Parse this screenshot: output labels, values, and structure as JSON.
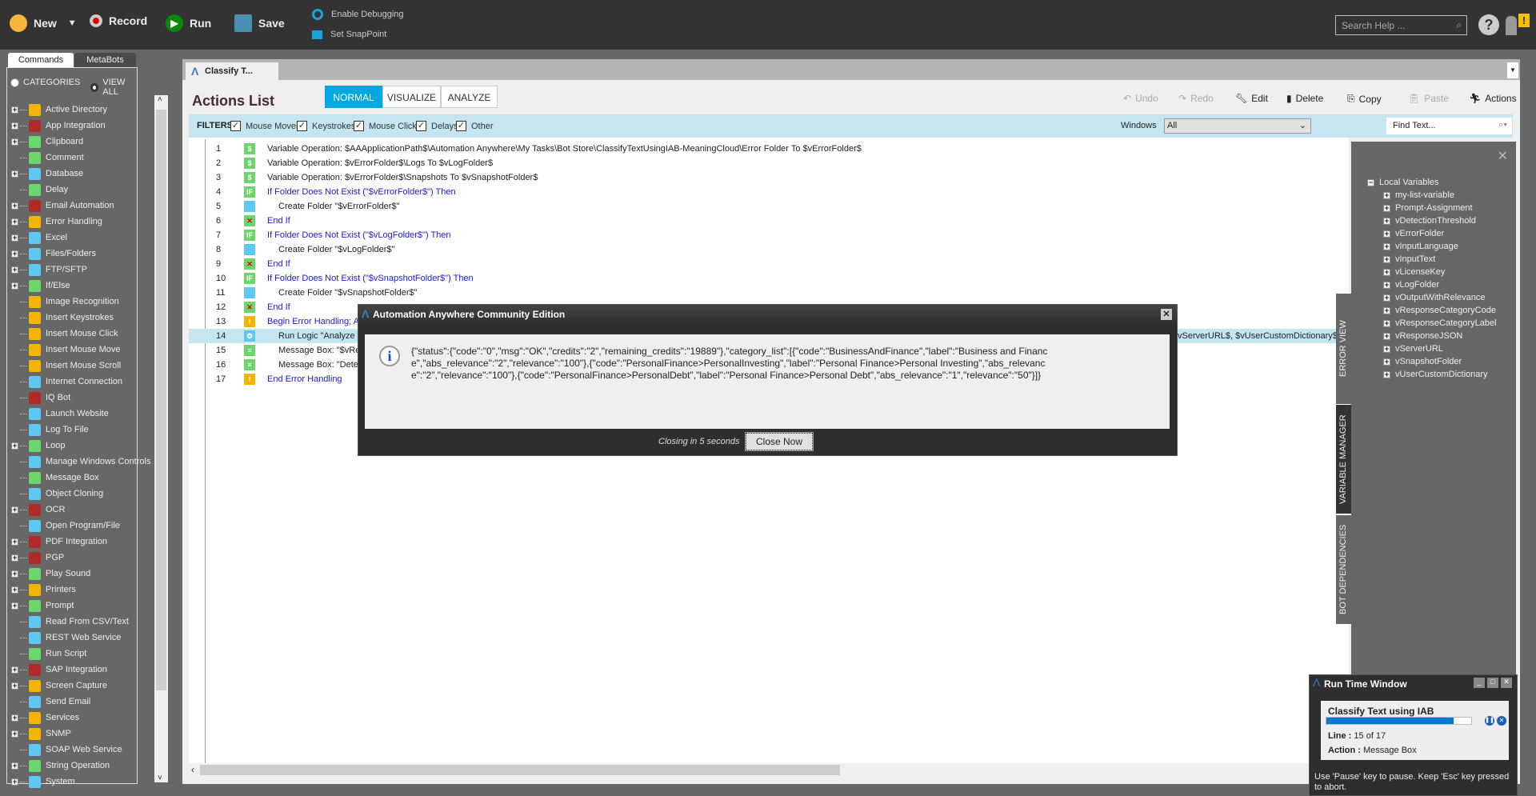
{
  "toolbar": {
    "new": "New",
    "record": "Record",
    "run": "Run",
    "save": "Save",
    "debug": "Enable Debugging",
    "snap": "Set SnapPoint",
    "search_placeholder": "Search Help ..."
  },
  "sidebar": {
    "tabs": [
      "Commands",
      "MetaBots"
    ],
    "radio_categories": "CATEGORIES",
    "radio_viewall": "VIEW ALL",
    "items": [
      {
        "label": "Active Directory",
        "exp": true,
        "color": "#f5b400"
      },
      {
        "label": "App Integration",
        "exp": true,
        "color": "#b02a2a"
      },
      {
        "label": "Clipboard",
        "exp": true,
        "color": "#6cd66c"
      },
      {
        "label": "Comment",
        "exp": false,
        "color": "#6cd66c"
      },
      {
        "label": "Database",
        "exp": true,
        "color": "#5ec8f0"
      },
      {
        "label": "Delay",
        "exp": false,
        "color": "#6cd66c"
      },
      {
        "label": "Email Automation",
        "exp": true,
        "color": "#b02a2a"
      },
      {
        "label": "Error Handling",
        "exp": true,
        "color": "#f5b400"
      },
      {
        "label": "Excel",
        "exp": true,
        "color": "#5ec8f0"
      },
      {
        "label": "Files/Folders",
        "exp": true,
        "color": "#5ec8f0"
      },
      {
        "label": "FTP/SFTP",
        "exp": true,
        "color": "#5ec8f0"
      },
      {
        "label": "If/Else",
        "exp": true,
        "color": "#6cd66c"
      },
      {
        "label": "Image Recognition",
        "exp": false,
        "color": "#f5b400"
      },
      {
        "label": "Insert Keystrokes",
        "exp": false,
        "color": "#f5b400"
      },
      {
        "label": "Insert Mouse Click",
        "exp": false,
        "color": "#f5b400"
      },
      {
        "label": "Insert Mouse Move",
        "exp": false,
        "color": "#f5b400"
      },
      {
        "label": "Insert Mouse Scroll",
        "exp": false,
        "color": "#f5b400"
      },
      {
        "label": "Internet Connection",
        "exp": false,
        "color": "#5ec8f0"
      },
      {
        "label": "IQ Bot",
        "exp": false,
        "color": "#b02a2a"
      },
      {
        "label": "Launch Website",
        "exp": false,
        "color": "#5ec8f0"
      },
      {
        "label": "Log To File",
        "exp": false,
        "color": "#5ec8f0"
      },
      {
        "label": "Loop",
        "exp": true,
        "color": "#6cd66c"
      },
      {
        "label": "Manage Windows Controls",
        "exp": false,
        "color": "#5ec8f0"
      },
      {
        "label": "Message Box",
        "exp": false,
        "color": "#6cd66c"
      },
      {
        "label": "Object Cloning",
        "exp": false,
        "color": "#5ec8f0"
      },
      {
        "label": "OCR",
        "exp": true,
        "color": "#b02a2a"
      },
      {
        "label": "Open Program/File",
        "exp": false,
        "color": "#5ec8f0"
      },
      {
        "label": "PDF Integration",
        "exp": true,
        "color": "#b02a2a"
      },
      {
        "label": "PGP",
        "exp": true,
        "color": "#b02a2a"
      },
      {
        "label": "Play Sound",
        "exp": true,
        "color": "#6cd66c"
      },
      {
        "label": "Printers",
        "exp": true,
        "color": "#f5b400"
      },
      {
        "label": "Prompt",
        "exp": true,
        "color": "#6cd66c"
      },
      {
        "label": "Read From CSV/Text",
        "exp": false,
        "color": "#5ec8f0"
      },
      {
        "label": "REST Web Service",
        "exp": false,
        "color": "#5ec8f0"
      },
      {
        "label": "Run Script",
        "exp": false,
        "color": "#6cd66c"
      },
      {
        "label": "SAP Integration",
        "exp": true,
        "color": "#b02a2a"
      },
      {
        "label": "Screen Capture",
        "exp": true,
        "color": "#f5b400"
      },
      {
        "label": "Send Email",
        "exp": false,
        "color": "#5ec8f0"
      },
      {
        "label": "Services",
        "exp": true,
        "color": "#f5b400"
      },
      {
        "label": "SNMP",
        "exp": true,
        "color": "#f5b400"
      },
      {
        "label": "SOAP Web Service",
        "exp": false,
        "color": "#5ec8f0"
      },
      {
        "label": "String Operation",
        "exp": true,
        "color": "#6cd66c"
      },
      {
        "label": "System",
        "exp": true,
        "color": "#5ec8f0"
      }
    ]
  },
  "main": {
    "tab": "Classify T...",
    "title": "Actions List",
    "modes": [
      "NORMAL",
      "VISUALIZE",
      "ANALYZE"
    ],
    "actions": {
      "undo": "Undo",
      "redo": "Redo",
      "edit": "Edit",
      "delete": "Delete",
      "copy": "Copy",
      "paste": "Paste",
      "actions": "Actions"
    },
    "filters": {
      "label": "FILTERS",
      "items": [
        "Mouse Moves",
        "Keystrokes",
        "Mouse Clicks",
        "Delays",
        "Other"
      ],
      "windows_label": "Windows",
      "windows_value": "All",
      "find_placeholder": "Find Text..."
    },
    "rows": [
      {
        "n": "1",
        "icon": "dollar",
        "text": "Variable Operation: $AAApplicationPath$\\Automation Anywhere\\My Tasks\\Bot Store\\ClassifyTextUsingIAB-MeaningCloud\\Error Folder To $vErrorFolder$",
        "indent": 0,
        "blue": false
      },
      {
        "n": "2",
        "icon": "dollar",
        "text": "Variable Operation: $vErrorFolder$\\Logs To $vLogFolder$",
        "indent": 0,
        "blue": false
      },
      {
        "n": "3",
        "icon": "dollar",
        "text": "Variable Operation: $vErrorFolder$\\Snapshots To $vSnapshotFolder$",
        "indent": 0,
        "blue": false
      },
      {
        "n": "4",
        "icon": "if",
        "text": "If Folder Does Not Exist (\"$vErrorFolder$\")  Then",
        "indent": 0,
        "blue": true
      },
      {
        "n": "5",
        "icon": "folder",
        "text": "Create Folder \"$vErrorFolder$\"",
        "indent": 1,
        "blue": false
      },
      {
        "n": "6",
        "icon": "endif",
        "text": "End If",
        "indent": 0,
        "blue": true
      },
      {
        "n": "7",
        "icon": "if",
        "text": "If Folder Does Not Exist (\"$vLogFolder$\")  Then",
        "indent": 0,
        "blue": true
      },
      {
        "n": "8",
        "icon": "folder",
        "text": "Create Folder \"$vLogFolder$\"",
        "indent": 1,
        "blue": false
      },
      {
        "n": "9",
        "icon": "endif",
        "text": "End If",
        "indent": 0,
        "blue": true
      },
      {
        "n": "10",
        "icon": "if",
        "text": "If Folder Does Not Exist (\"$vSnapshotFolder$\")  Then",
        "indent": 0,
        "blue": true
      },
      {
        "n": "11",
        "icon": "folder",
        "text": "Create Folder \"$vSnapshotFolder$\"",
        "indent": 1,
        "blue": false
      },
      {
        "n": "12",
        "icon": "endif",
        "text": "End If",
        "indent": 0,
        "blue": true
      },
      {
        "n": "13",
        "icon": "warning",
        "text": "Begin Error Handling; Ac",
        "indent": 0,
        "blue": true
      },
      {
        "n": "14",
        "icon": "runlogic",
        "text": "Run Logic \"Analyze t",
        "indent": 1,
        "blue": false,
        "selected": true,
        "tail": "vServerURL$, $vUserCustomDictionary$) C"
      },
      {
        "n": "15",
        "icon": "msg",
        "text": "Message Box: \"$vRe",
        "indent": 1,
        "blue": false
      },
      {
        "n": "16",
        "icon": "msg",
        "text": "Message Box: \"Dete",
        "indent": 1,
        "blue": false
      },
      {
        "n": "17",
        "icon": "warning",
        "text": "End Error Handling",
        "indent": 0,
        "blue": true
      }
    ]
  },
  "variables": {
    "root": "Local Variables",
    "items": [
      "my-list-variable",
      "Prompt-Assignment",
      "vDetectionThreshold",
      "vErrorFolder",
      "vInputLanguage",
      "vInputText",
      "vLicenseKey",
      "vLogFolder",
      "vOutputWithRelevance",
      "vResponseCategoryCode",
      "vResponseCategoryLabel",
      "vResponseJSON",
      "vServerURL",
      "vSnapshotFolder",
      "vUserCustomDictionary"
    ]
  },
  "side_tabs": [
    "ERROR VIEW",
    "VARIABLE MANAGER",
    "BOT DEPENDENCIES"
  ],
  "dialog": {
    "title": "Automation Anywhere Community Edition",
    "message": "{\"status\":{\"code\":\"0\",\"msg\":\"OK\",\"credits\":\"2\",\"remaining_credits\":\"19889\"},\"category_list\":[{\"code\":\"BusinessAndFinance\",\"label\":\"Business and Finance\",\"abs_relevance\":\"2\",\"relevance\":\"100\"},{\"code\":\"PersonalFinance>PersonalInvesting\",\"label\":\"Personal Finance>Personal Investing\",\"abs_relevance\":\"2\",\"relevance\":\"100\"},{\"code\":\"PersonalFinance>PersonalDebt\",\"label\":\"Personal Finance>Personal Debt\",\"abs_relevance\":\"1\",\"relevance\":\"50\"}]}",
    "closing": "Closing in 5 seconds",
    "close_now": "Close Now"
  },
  "runtime": {
    "title": "Run Time Window",
    "task": "Classify Text using IAB",
    "progress": 0.88,
    "line_label": "Line :",
    "line_value": "15 of 17",
    "action_label": "Action :",
    "action_value": "Message Box",
    "hint": "Use 'Pause' key to pause. Keep 'Esc' key pressed to abort."
  },
  "colors": {
    "accent": "#00a8e0",
    "progress": "#0078d7",
    "filter_bg": "#c5e6f0"
  }
}
